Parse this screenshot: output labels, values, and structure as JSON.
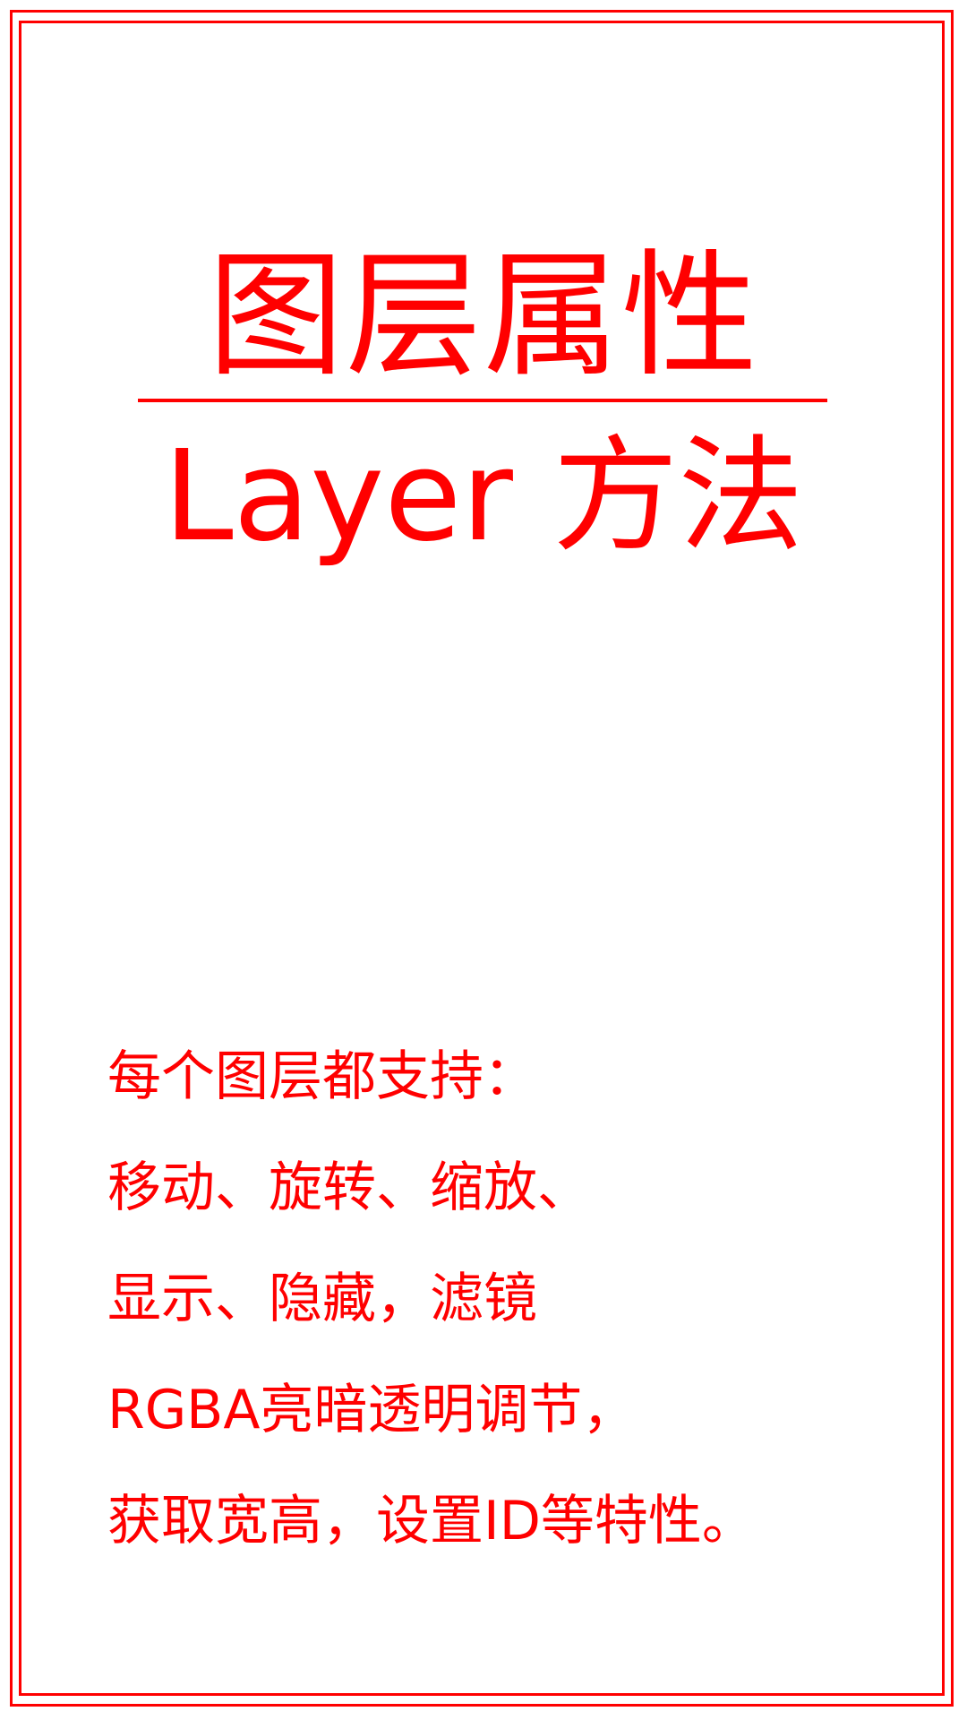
{
  "title": "图层属性",
  "subtitle": "Layer 方法",
  "description_lines": [
    "每个图层都支持：",
    "移动、旋转、缩放、",
    "显示、隐藏，滤镜",
    "RGBA亮暗透明调节，",
    "获取宽高，设置ID等特性。"
  ],
  "colors": {
    "accent": "#ff0000",
    "background": "#ffffff"
  }
}
